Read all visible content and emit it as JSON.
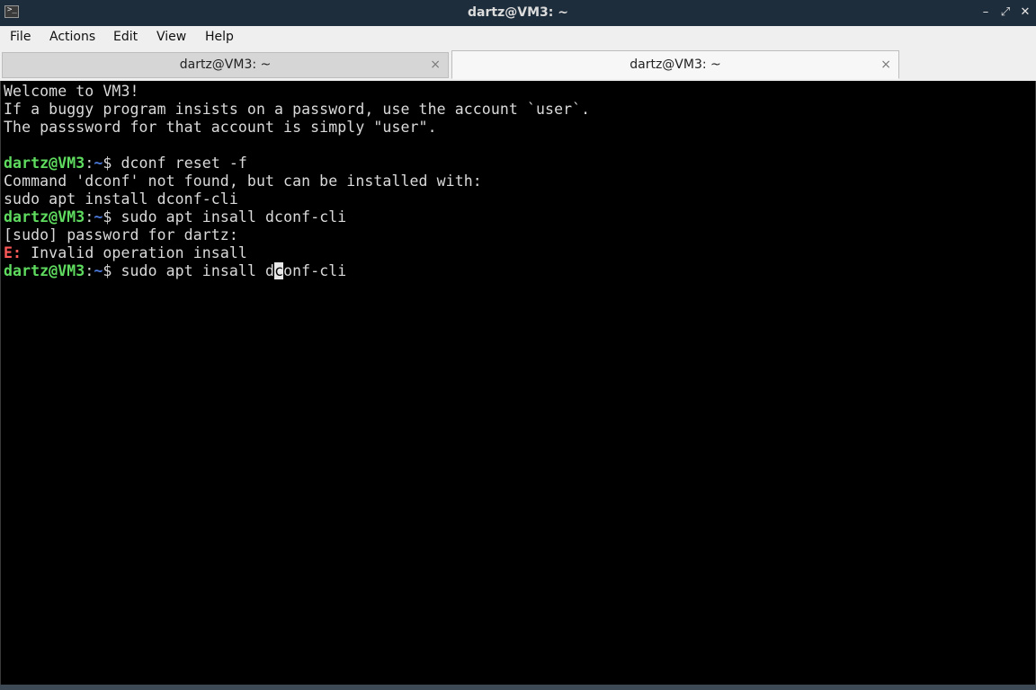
{
  "window": {
    "title": "dartz@VM3: ~",
    "app_icon_glyph": ">_",
    "controls": {
      "minimize": "–",
      "maximize": "⤢",
      "close": "✕"
    }
  },
  "menu": [
    "File",
    "Actions",
    "Edit",
    "View",
    "Help"
  ],
  "tabs": [
    {
      "label": "dartz@VM3: ~",
      "active": false,
      "close": "×"
    },
    {
      "label": "dartz@VM3: ~",
      "active": true,
      "close": "×"
    }
  ],
  "terminal": {
    "welcome": [
      "Welcome to VM3!",
      "If a buggy program insists on a password, use the account `user`.",
      "The passsword for that account is simply \"user\"."
    ],
    "prompt": {
      "user_host": "dartz@VM3",
      "sep": ":",
      "path": "~",
      "symbol": "$ "
    },
    "cmd1": "dconf reset -f",
    "out1": [
      "Command 'dconf' not found, but can be installed with:",
      "sudo apt install dconf-cli"
    ],
    "cmd2": "sudo apt insall dconf-cli",
    "out2": "[sudo] password for dartz:",
    "error_prefix": "E:",
    "error_text": " Invalid operation insall",
    "cmd3_before_cursor": "sudo apt insall d",
    "cmd3_cursor_char": "c",
    "cmd3_after_cursor": "onf-cli"
  },
  "colors": {
    "prompt_user": "#5fdc5f",
    "prompt_path": "#4a78d8",
    "error": "#ff5a5a",
    "titlebar": "#1e2d3c",
    "terminal_bg": "#000000"
  }
}
